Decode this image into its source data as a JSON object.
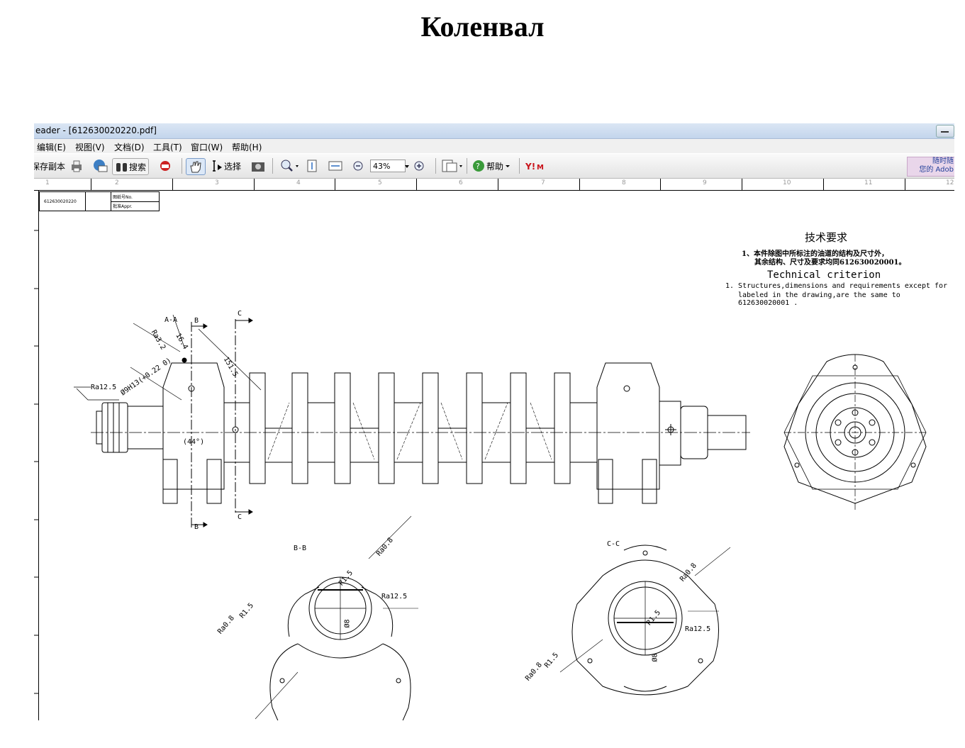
{
  "page_title": "Коленвал",
  "window": {
    "title": "eader - [612630020220.pdf]"
  },
  "menu": [
    "编辑(E)",
    "视图(V)",
    "文档(D)",
    "工具(T)",
    "窗口(W)",
    "帮助(H)"
  ],
  "toolbar": {
    "save_copy": "保存副本",
    "search": "搜索",
    "select": "选择",
    "zoom": "43%",
    "help": "帮助",
    "ad_line1": "随时随",
    "ad_line2": "您的 Adob"
  },
  "ruler": [
    "1",
    "2",
    "3",
    "4",
    "5",
    "6",
    "7",
    "8",
    "9",
    "10",
    "11",
    "12"
  ],
  "drawing": {
    "title_block_no": "612630020220",
    "title_block_r1": "图纸号No.",
    "title_block_r2": "批准Appr.",
    "tech_title_cn": "技术要求",
    "tech_cn_line1": "1、本件除图中所标注的油道的结构及尺寸外，",
    "tech_cn_line2": "其余结构、尺寸及要求均同612630020001。",
    "tech_title_en": "Technical criterion",
    "tech_en_line1": "1. Structures,dimensions and requirements except for",
    "tech_en_line2": "labeled in the drawing,are the same to 612630020001 .",
    "section_aa": "A-A",
    "section_bb": "B-B",
    "section_cc": "C-C",
    "mark_b": "B",
    "mark_c": "C",
    "ra32": "Ra3.2",
    "ra125": "Ra12.5",
    "ra08": "Ra0.8",
    "dim_164": "16.4",
    "dim_1515": "151.5",
    "dim_9h13": "Ø9H13(+0.22 0)",
    "dim_44": "(44°)",
    "dim_r15": "R1.5",
    "dim_d8": "Ø8"
  }
}
